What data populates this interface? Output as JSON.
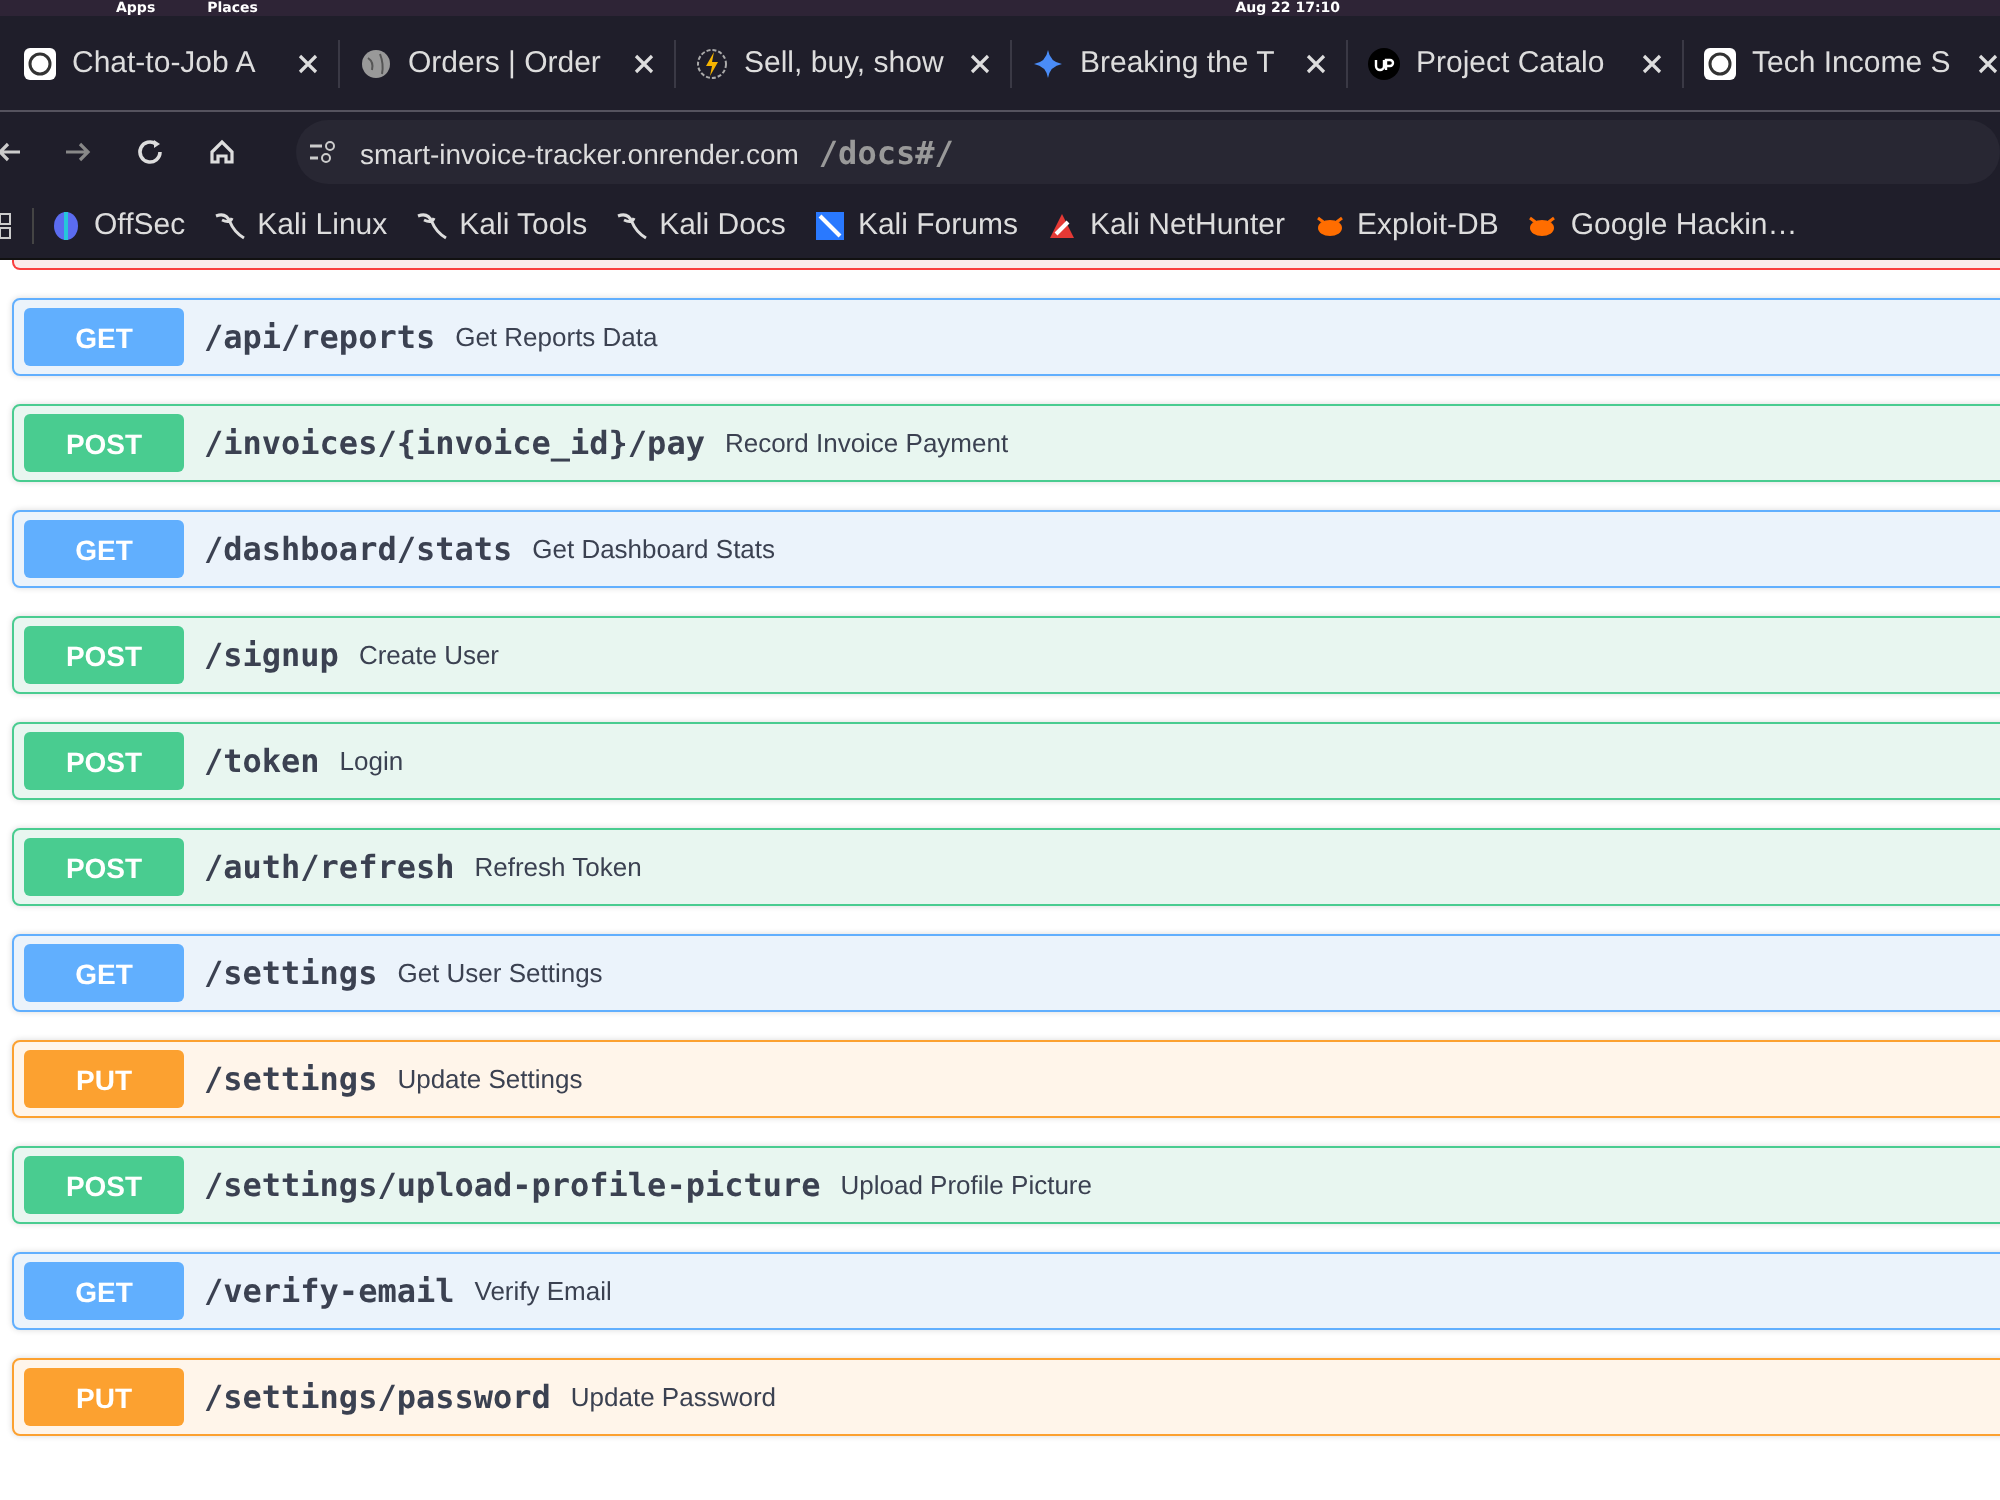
{
  "top_bar": {
    "menus": [
      "Apps",
      "Places"
    ],
    "clock": "Aug 22  17:10"
  },
  "tabs": [
    {
      "title": "Chat-to-Job A",
      "kind": "chat",
      "selected": false
    },
    {
      "title": "Orders | Order",
      "kind": "globe",
      "selected": false
    },
    {
      "title": "Sell, buy, show",
      "kind": "bolt",
      "selected": false
    },
    {
      "title": "Breaking the T",
      "kind": "star",
      "selected": false
    },
    {
      "title": "Project Catalo",
      "kind": "up",
      "selected": false
    },
    {
      "title": "Tech Income S",
      "kind": "chat",
      "selected": false
    }
  ],
  "address_bar": {
    "host": "smart-invoice-tracker.onrender.com",
    "path": "/docs#/"
  },
  "bookmarks": [
    {
      "label": "OffSec",
      "kind": "offsec"
    },
    {
      "label": "Kali Linux",
      "kind": "kali"
    },
    {
      "label": "Kali Tools",
      "kind": "kali"
    },
    {
      "label": "Kali Docs",
      "kind": "kali"
    },
    {
      "label": "Kali Forums",
      "kind": "forum"
    },
    {
      "label": "Kali NetHunter",
      "kind": "nethunter"
    },
    {
      "label": "Exploit-DB",
      "kind": "bug"
    },
    {
      "label": "Google Hackin…",
      "kind": "bug"
    }
  ],
  "endpoints": [
    {
      "method": "GET",
      "path": "/api/reports",
      "summary": "Get Reports Data"
    },
    {
      "method": "POST",
      "path": "/invoices/{invoice_id}/pay",
      "summary": "Record Invoice Payment"
    },
    {
      "method": "GET",
      "path": "/dashboard/stats",
      "summary": "Get Dashboard Stats"
    },
    {
      "method": "POST",
      "path": "/signup",
      "summary": "Create User"
    },
    {
      "method": "POST",
      "path": "/token",
      "summary": "Login"
    },
    {
      "method": "POST",
      "path": "/auth/refresh",
      "summary": "Refresh Token"
    },
    {
      "method": "GET",
      "path": "/settings",
      "summary": "Get User Settings"
    },
    {
      "method": "PUT",
      "path": "/settings",
      "summary": "Update Settings"
    },
    {
      "method": "POST",
      "path": "/settings/upload-profile-picture",
      "summary": "Upload Profile Picture"
    },
    {
      "method": "GET",
      "path": "/verify-email",
      "summary": "Verify Email"
    },
    {
      "method": "PUT",
      "path": "/settings/password",
      "summary": "Update Password"
    }
  ]
}
